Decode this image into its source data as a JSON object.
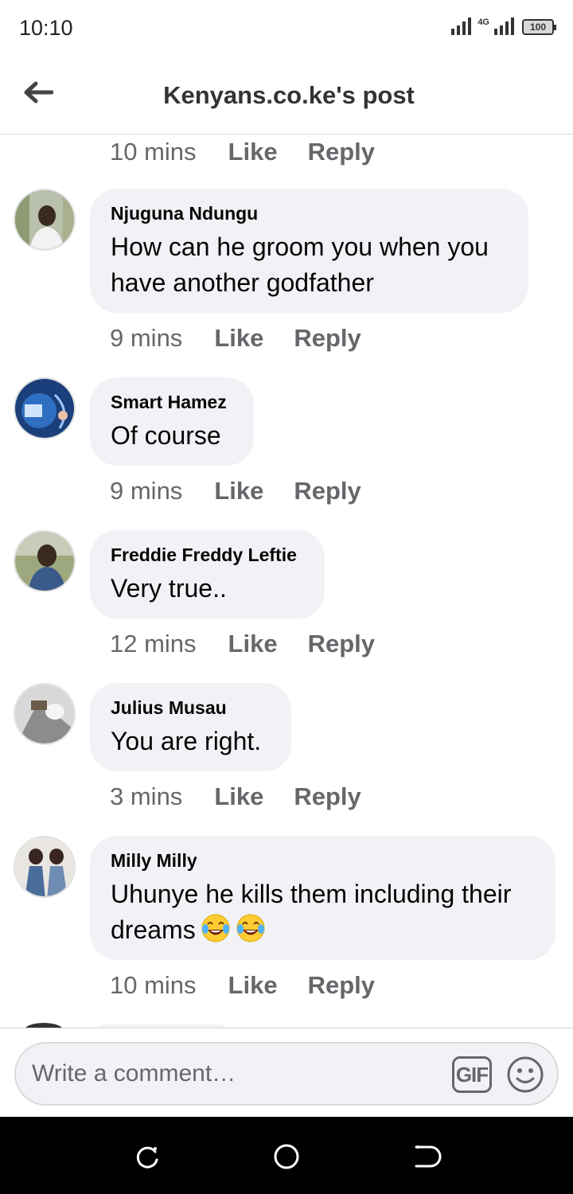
{
  "status_bar": {
    "time": "10:10",
    "network": "4G",
    "battery": "100"
  },
  "header": {
    "title": "Kenyans.co.ke's post"
  },
  "first_meta": {
    "time": "10 mins",
    "like": "Like",
    "reply": "Reply"
  },
  "comments": [
    {
      "author": "Njuguna Ndungu",
      "text": "How can he groom you when you have another godfather",
      "time": "9 mins",
      "like": "Like",
      "reply": "Reply"
    },
    {
      "author": "Smart Hamez",
      "text": "Of course",
      "time": "9 mins",
      "like": "Like",
      "reply": "Reply"
    },
    {
      "author": "Freddie Freddy Leftie",
      "text": "Very true..",
      "time": "12 mins",
      "like": "Like",
      "reply": "Reply"
    },
    {
      "author": "Julius Musau",
      "text": "You are right.",
      "time": "3 mins",
      "like": "Like",
      "reply": "Reply"
    },
    {
      "author": "Milly Milly",
      "text": "Uhunye he kills them including their dreams",
      "emoji": [
        "face-with-tears-of-joy",
        "face-with-tears-of-joy"
      ],
      "time": "10 mins",
      "like": "Like",
      "reply": "Reply"
    }
  ],
  "composer": {
    "placeholder": "Write a comment…",
    "gif_label": "GIF"
  },
  "icons": {
    "back": "arrow-left-icon",
    "emoji": "smiley-icon",
    "nav": [
      "recent-apps-icon",
      "home-icon",
      "back-icon"
    ]
  },
  "colors": {
    "bubble": "#f0f2f5",
    "meta": "#65676b",
    "nav": "#000000"
  }
}
